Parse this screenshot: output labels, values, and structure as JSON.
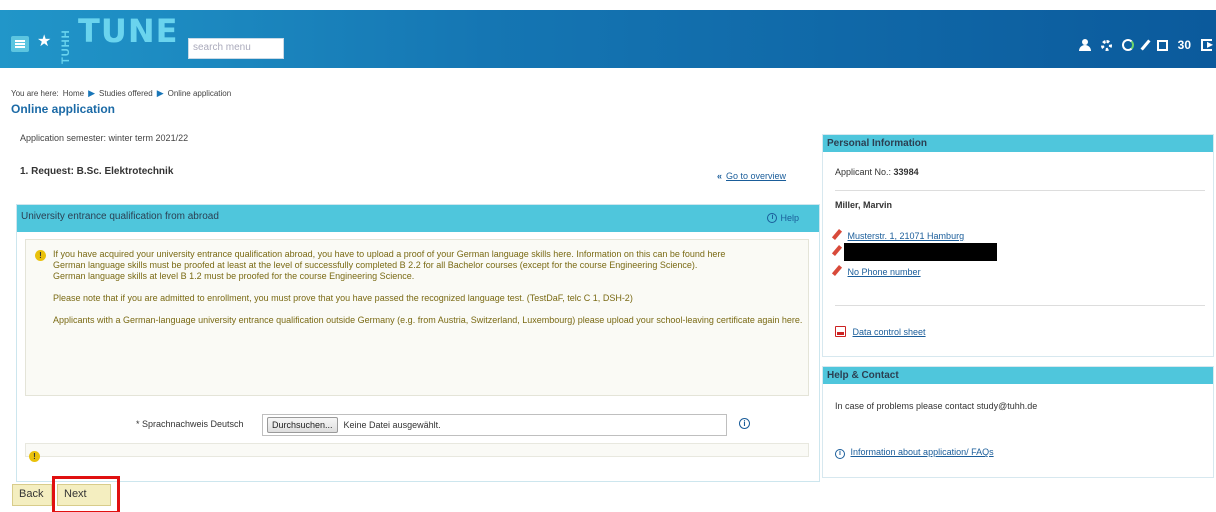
{
  "header": {
    "logo_vertical": "TUHH",
    "logo": "TUNE",
    "search_placeholder": "search menu",
    "counter": "30"
  },
  "breadcrumb": {
    "prefix": "You are here:",
    "items": [
      "Home",
      "Studies offered",
      "Online application"
    ]
  },
  "page": {
    "title": "Online application",
    "semester": "Application semester: winter term 2021/22",
    "request": "1. Request: B.Sc. Elektrotechnik",
    "goto_overview": "Go to overview"
  },
  "panel": {
    "title": "University entrance qualification from abroad",
    "help": "Help",
    "info_paragraphs": [
      "If you have acquired your university entrance qualification abroad, you have to upload a proof of your German language skills here. Information on this can be found here\nGerman language skills must be proofed at least at the level of successfully completed B 2.2 for all Bachelor courses (except for the course Engineering Science).\nGerman language skills at level B 1.2 must be proofed for the course Engineering Science.",
      "Please note that if you are admitted to enrollment, you must prove that you have passed the recognized language test. (TestDaF, telc C 1, DSH-2)",
      "Applicants with a German-language university entrance qualification outside Germany (e.g. from Austria, Switzerland, Luxembourg) please upload your school-leaving certificate again here."
    ],
    "field_label": "* Sprachnachweis Deutsch",
    "file_button": "Durchsuchen...",
    "file_status": "Keine Datei ausgewählt."
  },
  "buttons": {
    "back": "Back",
    "next": "Next"
  },
  "personal": {
    "title": "Personal Information",
    "applicant_label": "Applicant No.:",
    "applicant_no": "33984",
    "name": "Miller, Marvin",
    "address": "Musterstr. 1, 21071 Hamburg",
    "phone": "No Phone number",
    "data_sheet": "Data control sheet"
  },
  "contact": {
    "title": "Help & Contact",
    "text": "In case of problems please contact  study@tuhh.de",
    "faq": "Information about application/ FAQs"
  },
  "colors": {
    "header_start": "#2196c9",
    "header_end": "#0b5a9c",
    "panel_header": "#4fc6dc",
    "link": "#1a5d9a",
    "button_bg": "#f4eec0",
    "highlight": "#e01010"
  }
}
